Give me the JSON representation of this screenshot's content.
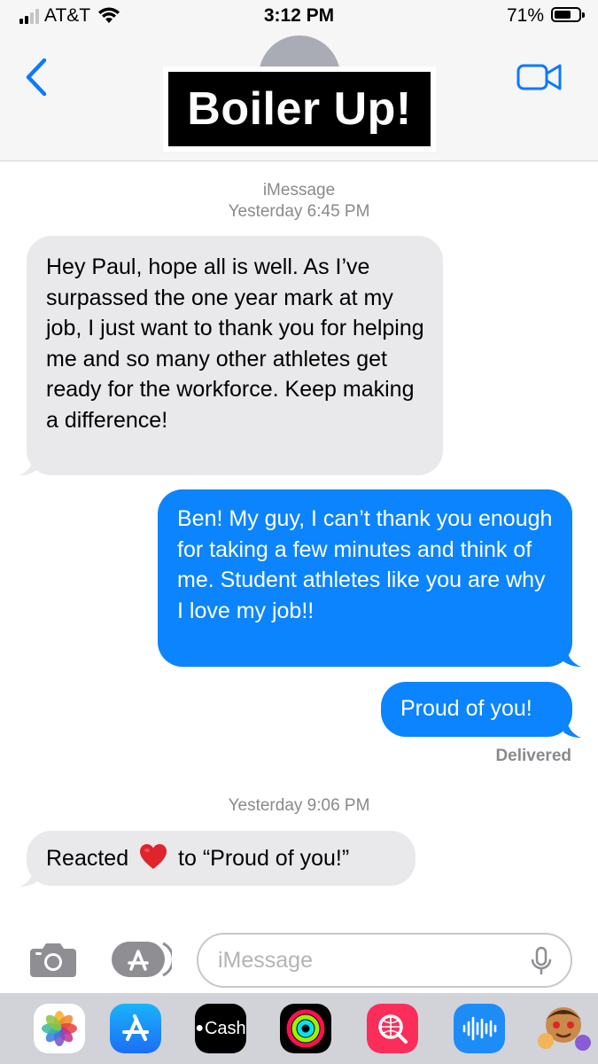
{
  "status_bar": {
    "carrier": "AT&T",
    "time": "3:12 PM",
    "battery_percent": "71%",
    "battery_level": 0.71,
    "signal_bars": 2
  },
  "header": {
    "title_overlay": "Boiler Up!",
    "back_icon": "chevron-left-icon",
    "video_icon": "video-camera-icon"
  },
  "conversation": {
    "service_label": "iMessage",
    "timestamp_1": "Yesterday 6:45 PM",
    "messages": [
      {
        "direction": "incoming",
        "text": "Hey Paul, hope all is well. As I’ve surpassed the one year mark at my job, I just want to thank you for helping me and so many other athletes get ready for the workforce. Keep making a difference!"
      },
      {
        "direction": "outgoing",
        "text": "Ben! My guy, I can’t thank you enough for taking a few minutes and think of me. Student athletes like you are why I love my job!!"
      },
      {
        "direction": "outgoing",
        "text": "Proud of you!"
      }
    ],
    "delivered": "Delivered",
    "timestamp_2": "Yesterday 9:06 PM",
    "reaction": {
      "prefix": "Reacted",
      "icon": "red-heart-icon",
      "suffix": "to “Proud of you!”"
    }
  },
  "input_bar": {
    "placeholder": "iMessage",
    "value": ""
  },
  "app_drawer": {
    "apps": [
      "Photos",
      "App Store",
      "Cash",
      "Activity",
      "Search Images",
      "Audio",
      "Memoji"
    ],
    "cash_label": "Cash"
  },
  "colors": {
    "outgoing_bubble": "#0b84fe",
    "incoming_bubble": "#e9e9eb",
    "accent": "#0a7aff",
    "heart": "#e0242b"
  }
}
